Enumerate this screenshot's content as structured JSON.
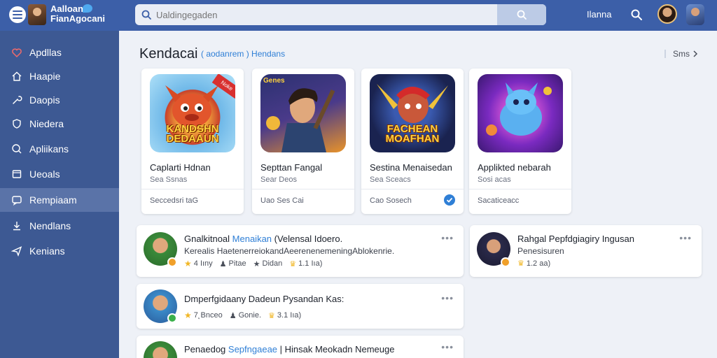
{
  "header": {
    "logo_line1": "Aalloan",
    "logo_line2": "FianAgocani",
    "search_placeholder": "Ualdingegaden",
    "nav_link": "Ilanna"
  },
  "sidebar": {
    "items": [
      {
        "label": "Apdllas",
        "icon": "heart-icon"
      },
      {
        "label": "Haapie",
        "icon": "home-icon"
      },
      {
        "label": "Daopis",
        "icon": "wrench-icon"
      },
      {
        "label": "Niedera",
        "icon": "shield-icon"
      },
      {
        "label": "Apliikans",
        "icon": "search-icon"
      },
      {
        "label": "Ueoals",
        "icon": "window-icon"
      },
      {
        "label": "Rempiaam",
        "icon": "chat-icon"
      },
      {
        "label": "Nendlans",
        "icon": "download-icon"
      },
      {
        "label": "Kenians",
        "icon": "send-icon"
      }
    ],
    "active_index": 6
  },
  "section": {
    "title": "Kendacai",
    "subtitle_link": "( aodanrem ) Hendans",
    "more_label": "Sms"
  },
  "apps": [
    {
      "name": "Caplarti Hdnan",
      "sub": "Sea Ssnas",
      "foot": "Seccedsri taG",
      "art_title": "KANDSHN DEDAAUN",
      "art_label": "",
      "ribbon": "Noke",
      "check": false,
      "colors": [
        "#e85b2f",
        "#7fc3f0"
      ]
    },
    {
      "name": "Septtan Fangal",
      "sub": "Sear Deos",
      "foot": "Uao Ses Cai",
      "art_title": "",
      "art_label": "Genes",
      "ribbon": "",
      "check": false,
      "colors": [
        "#3b3f86",
        "#f0a02a"
      ]
    },
    {
      "name": "Sestina Menaisedan",
      "sub": "Sea Sceacs",
      "foot": "Cao Sosech",
      "art_title": "FACHEAN MOAFHAN",
      "art_label": "",
      "ribbon": "",
      "check": true,
      "colors": [
        "#1e2b5c",
        "#f5c43a"
      ]
    },
    {
      "name": "Applikted nebarah",
      "sub": "Sosi acas",
      "foot": "Sacaticeacc",
      "art_title": "",
      "art_label": "",
      "ribbon": "",
      "check": false,
      "colors": [
        "#8a2fc8",
        "#f08a3a"
      ]
    }
  ],
  "feed": [
    {
      "title_a": "Gnalkitnoal ",
      "title_hl": "Menaikan",
      "title_b": " (Velensal Idoero.",
      "body": "Kerealis HaetenerreiokandAeerenenemeningAblokenrie.",
      "meta": [
        "4 Iıny",
        "Pitae",
        "Didan",
        "1.1 Iıa)"
      ]
    },
    {
      "title_a": "Dmperfgidaany Dadeun Pysandan Kas:",
      "title_hl": "",
      "title_b": "",
      "body": "",
      "meta": [
        "7˛Bnceo",
        "Gonie.",
        "3.1 Iıa)"
      ]
    },
    {
      "title_a": "Penaedog ",
      "title_hl": "Sepfngaeae",
      "title_b": " | Hinsak Meokadn Nemeuge",
      "body": "",
      "meta": []
    },
    {
      "title_a": "Rahgal Pepfdgiagiry Ingusan",
      "title_hl": "",
      "title_b": "",
      "body": "Penesisuren",
      "meta": [
        "1.2 aa)"
      ]
    }
  ],
  "colors": {
    "topbar": "#3c5fa8",
    "sidebar": "#3d5993",
    "sidebar_active": "#5a73a8",
    "accent": "#2f7fd6"
  }
}
